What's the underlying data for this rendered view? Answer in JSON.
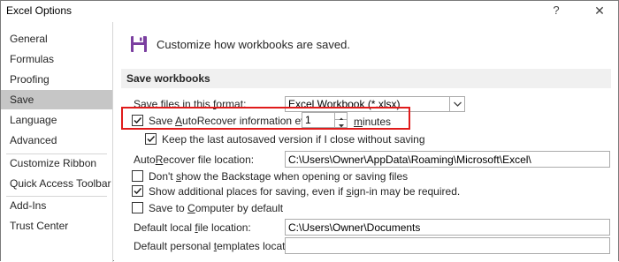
{
  "window": {
    "title": "Excel Options",
    "help_glyph": "?",
    "close_glyph": "✕"
  },
  "sidebar": {
    "items": [
      {
        "label": "General"
      },
      {
        "label": "Formulas"
      },
      {
        "label": "Proofing"
      },
      {
        "label": "Save",
        "selected": true
      },
      {
        "label": "Language"
      },
      {
        "label": "Advanced"
      },
      {
        "label": "Customize Ribbon"
      },
      {
        "label": "Quick Access Toolbar"
      },
      {
        "label": "Add-Ins"
      },
      {
        "label": "Trust Center"
      }
    ]
  },
  "main": {
    "header_icon": "save-disk-icon",
    "header_text": "Customize how workbooks are saved.",
    "section_title": "Save workbooks",
    "save_format": {
      "label_pre": "Save files in this ",
      "label_u": "f",
      "label_post": "ormat:",
      "value": "Excel Workbook (*.xlsx)"
    },
    "autorecover": {
      "label_pre": "Save ",
      "label_u": "A",
      "label_post": "utoRecover information every",
      "checked": true,
      "minutes_value": "1",
      "minutes_u": "m",
      "minutes_post": "inutes"
    },
    "keep_last": {
      "label": "Keep the last autosaved version if I close without saving",
      "checked": true
    },
    "autorecover_location": {
      "label_pre": "Auto",
      "label_u": "R",
      "label_post": "ecover file location:",
      "value": "C:\\Users\\Owner\\AppData\\Roaming\\Microsoft\\Excel\\"
    },
    "dont_show_backstage": {
      "label_pre": "Don't ",
      "label_u": "s",
      "label_post": "how the Backstage when opening or saving files",
      "checked": false
    },
    "show_additional_places": {
      "label_pre": "Show additional places for saving, even if ",
      "label_u": "s",
      "label_post": "ign-in may be required.",
      "checked": true
    },
    "save_to_computer": {
      "label_pre": "Save to ",
      "label_u": "C",
      "label_post": "omputer by default",
      "checked": false
    },
    "default_local": {
      "label_pre": "Default local ",
      "label_u": "f",
      "label_post": "ile location:",
      "value": "C:\\Users\\Owner\\Documents"
    },
    "default_templates": {
      "label_pre": "Default personal ",
      "label_u": "t",
      "label_post": "emplates location:",
      "value": ""
    }
  },
  "colors": {
    "highlight_border": "#e01b1b",
    "selected_nav": "#c6c6c6",
    "section_bg": "#f0f0f0",
    "save_icon": "#7b3fa0"
  }
}
